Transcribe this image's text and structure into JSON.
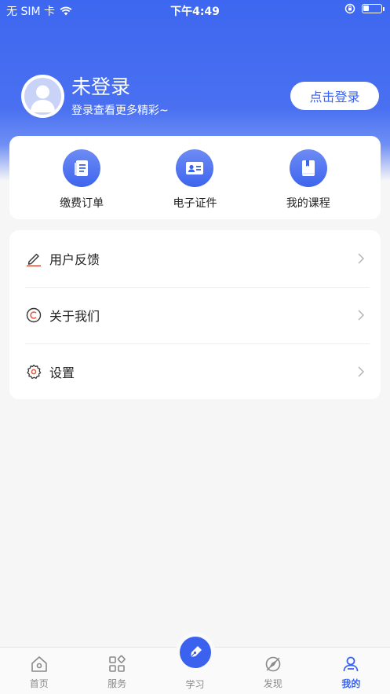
{
  "status_bar": {
    "carrier": "无 SIM 卡",
    "time": "下午4:49",
    "battery_level": 0.35
  },
  "profile": {
    "name": "未登录",
    "subtitle": "登录查看更多精彩~",
    "login_button": "点击登录"
  },
  "quick_actions": [
    {
      "label": "缴费订单",
      "icon": "document-icon"
    },
    {
      "label": "电子证件",
      "icon": "id-card-icon"
    },
    {
      "label": "我的课程",
      "icon": "book-icon"
    }
  ],
  "menu": [
    {
      "label": "用户反馈",
      "icon": "pencil-icon"
    },
    {
      "label": "关于我们",
      "icon": "copyright-icon"
    },
    {
      "label": "设置",
      "icon": "gear-icon"
    }
  ],
  "tabbar": [
    {
      "label": "首页",
      "icon": "home-icon",
      "active": false
    },
    {
      "label": "服务",
      "icon": "grid-icon",
      "active": false
    },
    {
      "label": "学习",
      "icon": "pen-nib-icon",
      "active": false
    },
    {
      "label": "发现",
      "icon": "compass-icon",
      "active": false
    },
    {
      "label": "我的",
      "icon": "user-icon",
      "active": true
    }
  ],
  "colors": {
    "primary": "#3a62ef",
    "background": "#f6f6f7",
    "feedback_underline": "#e8573b",
    "copyright_accent": "#e8573b"
  }
}
